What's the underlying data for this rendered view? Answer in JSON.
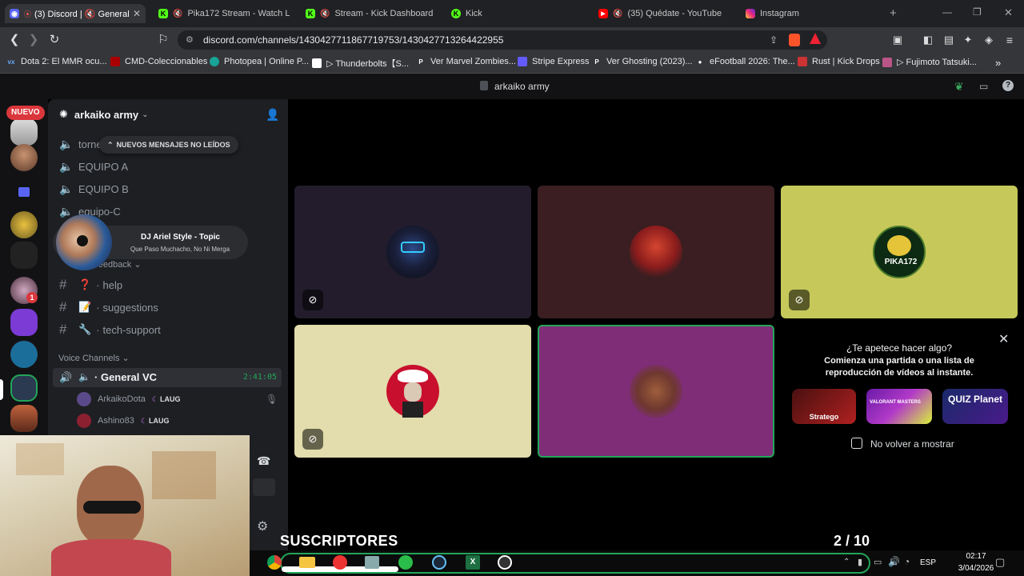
{
  "browser": {
    "tabs": [
      {
        "label": "(3) Discord | 🔇 General",
        "active": true
      },
      {
        "label": "Pika172 Stream - Watch Live"
      },
      {
        "label": "Stream - Kick Dashboard"
      },
      {
        "label": "Kick"
      },
      {
        "label": "(35) Quédate - YouTube"
      },
      {
        "label": "Instagram"
      }
    ],
    "url": "discord.com/channels/1430427711867719753/1430427713264422955",
    "bookmarks": [
      "Dota 2: El MMR ocu...",
      "CMD-Coleccionables",
      "Photopea | Online P...",
      "▷ Thunderbolts【S...",
      "Ver Marvel Zombies...",
      "Stripe Express",
      "Ver Ghosting (2023)...",
      "eFootball 2026: The...",
      "Rust | Kick Drops",
      "▷ Fujimoto Tatsuki..."
    ]
  },
  "discord": {
    "window_title": "arkaiko army",
    "new_badge": "NUEVO",
    "unread_badge": "1",
    "server_name": "arkaiko army",
    "unread_banner": "NUEVOS MENSAJES NO LEÍDOS",
    "channels": [
      {
        "name": "torne",
        "type": "voice"
      },
      {
        "name": "EQUIPO A",
        "type": "voice"
      },
      {
        "name": "EQUIPO B",
        "type": "voice"
      },
      {
        "name": "equipo-C",
        "type": "voice"
      }
    ],
    "category_feedback": "Feedback",
    "text_channels": [
      {
        "emoji": "❓",
        "name": "help"
      },
      {
        "emoji": "📝",
        "name": "suggestions"
      },
      {
        "emoji": "🔧",
        "name": "tech-support"
      }
    ],
    "voice_category": "Voice Channels",
    "voice_channel": {
      "name": "General VC",
      "timer": "2:41:05"
    },
    "voice_users": [
      {
        "name": "ArkaikoDota",
        "tag": "LAUG"
      },
      {
        "name": "Ashino83",
        "tag": "LAUG"
      }
    ],
    "activity_prompt": {
      "title": "¿Te apetece hacer algo?",
      "body": "Comienza una partida o una lista de reproducción de vídeos al instante.",
      "games": [
        "Stratego",
        "VALORANT MASTERS",
        "QUIZ Planet"
      ],
      "checkbox_label": "No volver a mostrar"
    }
  },
  "music_overlay": {
    "artist": "DJ Ariel Style - Topic",
    "track": "Que Paso Muchacho, No Ni Merga"
  },
  "stream_overlay": {
    "subscribers_label": "SUSCRIPTORES",
    "subscribers_count": "2 / 10"
  },
  "taskbar": {
    "language": "ESP",
    "time": "02:17",
    "date": "3/04/2026"
  },
  "tiles": [
    {
      "user": "tile-1",
      "bg": "#221c2c",
      "muted": true
    },
    {
      "user": "tile-2",
      "bg": "#3a1e21",
      "muted": false
    },
    {
      "user": "pika172",
      "bg": "#c6c85a",
      "muted": true,
      "label": "PIKA172"
    },
    {
      "user": "tile-4",
      "bg": "#e3dcac",
      "muted": true
    },
    {
      "user": "tile-5",
      "bg": "#7e2d76",
      "muted": false,
      "speaking": true
    }
  ],
  "colors": {
    "discord_bg": "#1e1f22",
    "accent_green": "#23a55a",
    "badge_red": "#da373c",
    "brand_purple": "#5865f2"
  }
}
